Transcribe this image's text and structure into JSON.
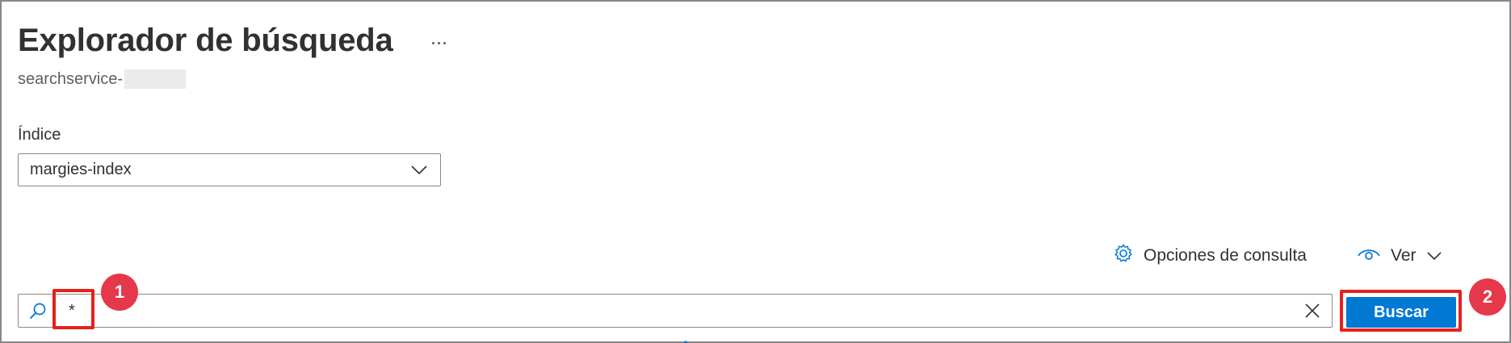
{
  "page": {
    "title": "Explorador de búsqueda",
    "subtitle": "searchservice-",
    "more_icon": "more-horizontal-icon"
  },
  "index_field": {
    "label": "Índice",
    "selected": "margies-index",
    "icon": "chevron-down-icon"
  },
  "toolbar": {
    "query_options_label": "Opciones de consulta",
    "query_options_icon": "gear-icon",
    "view_label": "Ver",
    "view_icon": "eye-icon",
    "view_chevron_icon": "chevron-down-icon"
  },
  "search": {
    "query": "*",
    "search_icon": "search-icon",
    "clear_icon": "close-icon",
    "button_label": "Buscar"
  },
  "annotations": {
    "badge_1": "1",
    "badge_2": "2",
    "highlight_color": "#e8201a",
    "badge_color": "#e5384a"
  },
  "colors": {
    "accent": "#0078d4",
    "text": "#323130",
    "subtle_text": "#605e5c",
    "border": "#8a8886"
  }
}
